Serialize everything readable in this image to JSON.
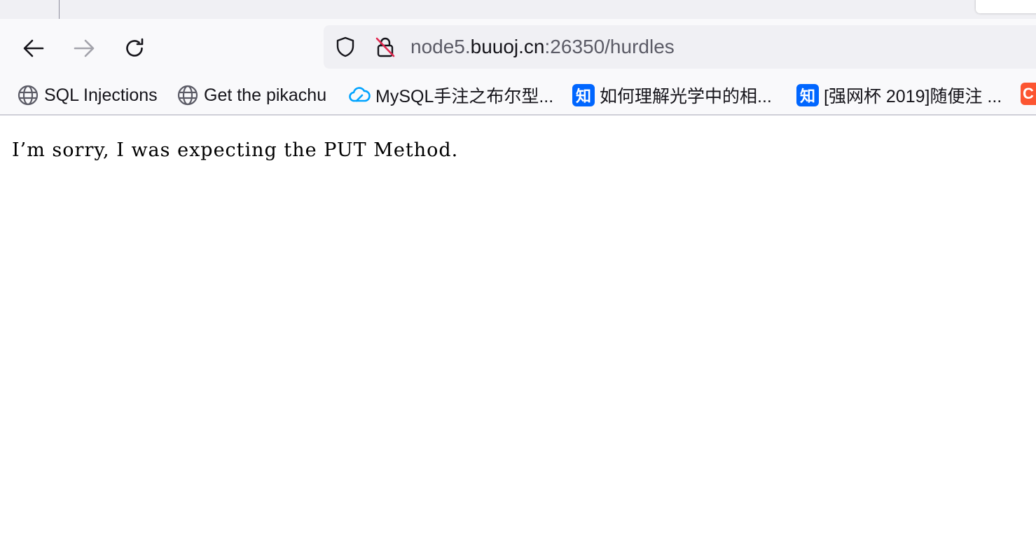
{
  "browser": {
    "url": {
      "prefix": "node5.",
      "host": "buuoj.cn",
      "suffix": ":26350/hurdles"
    },
    "nav": {
      "back_icon": "arrow-left-icon",
      "forward_icon": "arrow-right-icon",
      "reload_icon": "reload-icon"
    },
    "bookmarks": [
      {
        "label": "SQL Injections",
        "icon": "globe-icon"
      },
      {
        "label": "Get the pikachu",
        "icon": "globe-icon"
      },
      {
        "label": "MySQL手注之布尔型...",
        "icon": "cloud-icon"
      },
      {
        "label": "如何理解光学中的相...",
        "icon": "zhihu-icon",
        "icon_text": "知"
      },
      {
        "label": "[强网杯 2019]随便注 ...",
        "icon": "zhihu-icon",
        "icon_text": "知"
      }
    ],
    "overflow_bookmark": {
      "icon": "csdn-icon",
      "icon_text": "C"
    }
  },
  "page": {
    "message": "I’m sorry, I was expecting the PUT Method."
  },
  "colors": {
    "zhihu_blue": "#0066ff",
    "csdn_orange": "#fc5531",
    "cloud_blue": "#00a3ff"
  }
}
